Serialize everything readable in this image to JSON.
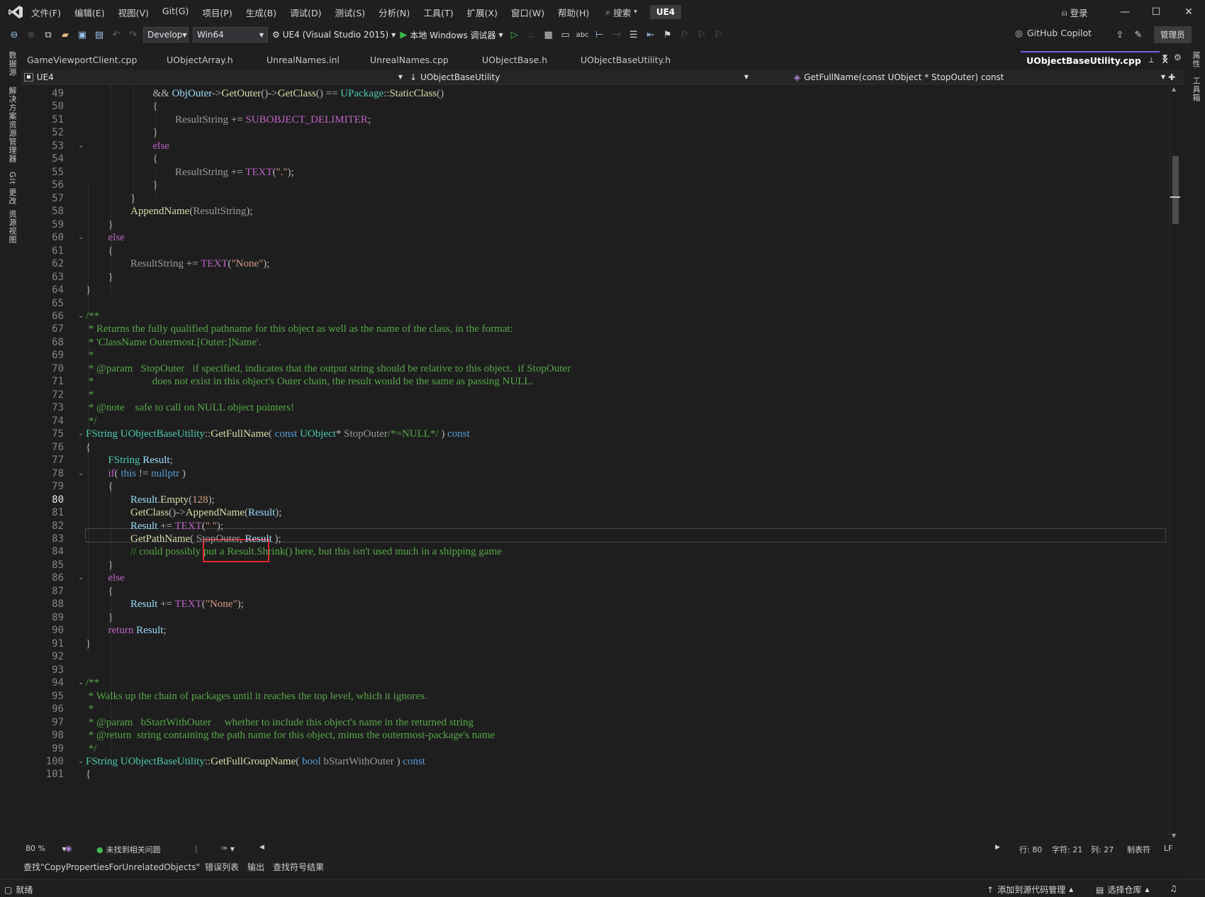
{
  "menu": {
    "items": [
      "文件(F)",
      "编辑(E)",
      "视图(V)",
      "Git(G)",
      "项目(P)",
      "生成(B)",
      "调试(D)",
      "测试(S)",
      "分析(N)",
      "工具(T)",
      "扩展(X)",
      "窗口(W)",
      "帮助(H)"
    ],
    "search_label": "搜索",
    "solution_badge": "UE4",
    "login_label": "登录"
  },
  "toolbar": {
    "config_value": "Develop",
    "platform_value": "Win64",
    "startup_project": "UE4 (Visual Studio 2015)",
    "debugger_label": "本地 Windows 调试器",
    "copilot_label": "GitHub Copilot",
    "admin_label": "管理员"
  },
  "left_strip": {
    "tabs": [
      "数据源",
      "解决方案资源管理器",
      "Git 更改",
      "资源视图"
    ]
  },
  "right_strip": {
    "tabs": [
      "属性",
      "工具箱"
    ]
  },
  "doc_tabs": {
    "tabs": [
      "GameViewportClient.cpp",
      "UObjectArray.h",
      "UnrealNames.inl",
      "UnrealNames.cpp",
      "UObjectBase.h",
      "UObjectBaseUtility.h"
    ],
    "active": "UObjectBaseUtility.cpp"
  },
  "navbar": {
    "project": "UE4",
    "scope": "UObjectBaseUtility",
    "member": "GetFullName(const UObject * StopOuter) const"
  },
  "editor": {
    "current_line": 80,
    "highlighted_token": "AppendName",
    "lines": [
      {
        "n": "49",
        "fold": "",
        "indent": 3,
        "toks": [
          {
            "t": "&& ",
            "c": "op"
          },
          {
            "t": "ObjOuter",
            "c": "va"
          },
          {
            "t": "->",
            "c": "op"
          },
          {
            "t": "GetOuter",
            "c": "fn"
          },
          {
            "t": "()",
            "c": "op"
          },
          {
            "t": "->",
            "c": "op"
          },
          {
            "t": "GetClass",
            "c": "fn"
          },
          {
            "t": "() == ",
            "c": "op"
          },
          {
            "t": "UPackage",
            "c": "ty"
          },
          {
            "t": "::",
            "c": "op"
          },
          {
            "t": "StaticClass",
            "c": "fn"
          },
          {
            "t": "()",
            "c": "op"
          }
        ]
      },
      {
        "n": "50",
        "fold": "",
        "indent": 3,
        "toks": [
          {
            "t": "{",
            "c": "op"
          }
        ]
      },
      {
        "n": "51",
        "fold": "",
        "indent": 4,
        "toks": [
          {
            "t": "ResultString",
            "c": "pm"
          },
          {
            "t": " += ",
            "c": "op"
          },
          {
            "t": "SUBOBJECT_DELIMITER",
            "c": "mc"
          },
          {
            "t": ";",
            "c": "op"
          }
        ]
      },
      {
        "n": "52",
        "fold": "",
        "indent": 3,
        "toks": [
          {
            "t": "}",
            "c": "op"
          }
        ]
      },
      {
        "n": "53",
        "fold": "⌄",
        "indent": 3,
        "toks": [
          {
            "t": "else",
            "c": "mc"
          }
        ]
      },
      {
        "n": "54",
        "fold": "",
        "indent": 3,
        "toks": [
          {
            "t": "{",
            "c": "op"
          }
        ]
      },
      {
        "n": "55",
        "fold": "",
        "indent": 4,
        "toks": [
          {
            "t": "ResultString",
            "c": "pm"
          },
          {
            "t": " += ",
            "c": "op"
          },
          {
            "t": "TEXT",
            "c": "mc"
          },
          {
            "t": "(",
            "c": "op"
          },
          {
            "t": "\".\"",
            "c": "st"
          },
          {
            "t": ");",
            "c": "op"
          }
        ]
      },
      {
        "n": "56",
        "fold": "",
        "indent": 3,
        "toks": [
          {
            "t": "}",
            "c": "op"
          }
        ]
      },
      {
        "n": "57",
        "fold": "",
        "indent": 2,
        "toks": [
          {
            "t": "}",
            "c": "op"
          }
        ]
      },
      {
        "n": "58",
        "fold": "",
        "indent": 2,
        "toks": [
          {
            "t": "AppendName",
            "c": "fn"
          },
          {
            "t": "(",
            "c": "op"
          },
          {
            "t": "ResultString",
            "c": "pm"
          },
          {
            "t": ");",
            "c": "op"
          }
        ]
      },
      {
        "n": "59",
        "fold": "",
        "indent": 1,
        "toks": [
          {
            "t": "}",
            "c": "op"
          }
        ]
      },
      {
        "n": "60",
        "fold": "⌄",
        "indent": 1,
        "toks": [
          {
            "t": "else",
            "c": "mc"
          }
        ]
      },
      {
        "n": "61",
        "fold": "",
        "indent": 1,
        "toks": [
          {
            "t": "{",
            "c": "op"
          }
        ]
      },
      {
        "n": "62",
        "fold": "",
        "indent": 2,
        "toks": [
          {
            "t": "ResultString",
            "c": "pm"
          },
          {
            "t": " += ",
            "c": "op"
          },
          {
            "t": "TEXT",
            "c": "mc"
          },
          {
            "t": "(",
            "c": "op"
          },
          {
            "t": "\"None\"",
            "c": "st"
          },
          {
            "t": ");",
            "c": "op"
          }
        ]
      },
      {
        "n": "63",
        "fold": "",
        "indent": 1,
        "toks": [
          {
            "t": "}",
            "c": "op"
          }
        ]
      },
      {
        "n": "64",
        "fold": "",
        "indent": 0,
        "toks": [
          {
            "t": "}",
            "c": "op"
          }
        ]
      },
      {
        "n": "65",
        "fold": "",
        "indent": 0,
        "toks": []
      },
      {
        "n": "66",
        "fold": "⌄",
        "indent": 0,
        "toks": [
          {
            "t": "/**",
            "c": "cm"
          }
        ]
      },
      {
        "n": "67",
        "fold": "",
        "indent": 0,
        "toks": [
          {
            "t": " * Returns the fully qualified pathname for this object as well as the name of the class, in the format:",
            "c": "cm"
          }
        ]
      },
      {
        "n": "68",
        "fold": "",
        "indent": 0,
        "toks": [
          {
            "t": " * 'ClassName Outermost.[Outer:]Name'.",
            "c": "cm"
          }
        ]
      },
      {
        "n": "69",
        "fold": "",
        "indent": 0,
        "toks": [
          {
            "t": " *",
            "c": "cm"
          }
        ]
      },
      {
        "n": "70",
        "fold": "",
        "indent": 0,
        "toks": [
          {
            "t": " * @param   StopOuter   if specified, indicates that the output string should be relative to this object.  if StopOuter",
            "c": "cm"
          }
        ]
      },
      {
        "n": "71",
        "fold": "",
        "indent": 0,
        "toks": [
          {
            "t": " *                      does not exist in this object's Outer chain, the result would be the same as passing NULL.",
            "c": "cm"
          }
        ]
      },
      {
        "n": "72",
        "fold": "",
        "indent": 0,
        "toks": [
          {
            "t": " *",
            "c": "cm"
          }
        ]
      },
      {
        "n": "73",
        "fold": "",
        "indent": 0,
        "toks": [
          {
            "t": " * @note    safe to call on NULL object pointers!",
            "c": "cm"
          }
        ]
      },
      {
        "n": "74",
        "fold": "",
        "indent": 0,
        "toks": [
          {
            "t": " */",
            "c": "cm"
          }
        ]
      },
      {
        "n": "75",
        "fold": "⌄",
        "indent": 0,
        "toks": [
          {
            "t": "FString",
            "c": "ty"
          },
          {
            "t": " ",
            "c": "op"
          },
          {
            "t": "UObjectBaseUtility",
            "c": "ty"
          },
          {
            "t": "::",
            "c": "op"
          },
          {
            "t": "GetFullName",
            "c": "fn"
          },
          {
            "t": "( ",
            "c": "op"
          },
          {
            "t": "const",
            "c": "kw"
          },
          {
            "t": " ",
            "c": "op"
          },
          {
            "t": "UObject",
            "c": "ty"
          },
          {
            "t": "* ",
            "c": "op"
          },
          {
            "t": "StopOuter",
            "c": "pm"
          },
          {
            "t": "/*=NULL*/",
            "c": "cm"
          },
          {
            "t": " ) ",
            "c": "op"
          },
          {
            "t": "const",
            "c": "kw"
          }
        ]
      },
      {
        "n": "76",
        "fold": "",
        "indent": 0,
        "toks": [
          {
            "t": "{",
            "c": "op"
          }
        ]
      },
      {
        "n": "77",
        "fold": "",
        "indent": 1,
        "toks": [
          {
            "t": "FString",
            "c": "ty"
          },
          {
            "t": " ",
            "c": "op"
          },
          {
            "t": "Result",
            "c": "va"
          },
          {
            "t": ";",
            "c": "op"
          }
        ]
      },
      {
        "n": "78",
        "fold": "⌄",
        "indent": 1,
        "toks": [
          {
            "t": "if",
            "c": "mc"
          },
          {
            "t": "( ",
            "c": "op"
          },
          {
            "t": "this",
            "c": "kw"
          },
          {
            "t": " != ",
            "c": "op"
          },
          {
            "t": "nullptr",
            "c": "kw"
          },
          {
            "t": " )",
            "c": "op"
          }
        ]
      },
      {
        "n": "79",
        "fold": "",
        "indent": 1,
        "toks": [
          {
            "t": "{",
            "c": "op"
          }
        ]
      },
      {
        "n": "80",
        "fold": "",
        "indent": 2,
        "toks": [
          {
            "t": "Result",
            "c": "va"
          },
          {
            "t": ".",
            "c": "op"
          },
          {
            "t": "Empty",
            "c": "fn"
          },
          {
            "t": "(",
            "c": "op"
          },
          {
            "t": "128",
            "c": "st"
          },
          {
            "t": ");",
            "c": "op"
          }
        ]
      },
      {
        "n": "81",
        "fold": "",
        "indent": 2,
        "toks": [
          {
            "t": "GetClass",
            "c": "fn"
          },
          {
            "t": "()->",
            "c": "op"
          },
          {
            "t": "AppendName",
            "c": "fn"
          },
          {
            "t": "(",
            "c": "op"
          },
          {
            "t": "Result",
            "c": "va"
          },
          {
            "t": ");",
            "c": "op"
          }
        ]
      },
      {
        "n": "82",
        "fold": "",
        "indent": 2,
        "toks": [
          {
            "t": "Result",
            "c": "va"
          },
          {
            "t": " += ",
            "c": "op"
          },
          {
            "t": "TEXT",
            "c": "mc"
          },
          {
            "t": "(",
            "c": "op"
          },
          {
            "t": "\" \"",
            "c": "st"
          },
          {
            "t": ");",
            "c": "op"
          }
        ]
      },
      {
        "n": "83",
        "fold": "",
        "indent": 2,
        "toks": [
          {
            "t": "GetPathName",
            "c": "fn"
          },
          {
            "t": "( ",
            "c": "op"
          },
          {
            "t": "StopOuter",
            "c": "pm"
          },
          {
            "t": ", ",
            "c": "op"
          },
          {
            "t": "Result",
            "c": "va"
          },
          {
            "t": " );",
            "c": "op"
          }
        ]
      },
      {
        "n": "84",
        "fold": "",
        "indent": 2,
        "toks": [
          {
            "t": "// could possibly put a Result.Shrink() here, but this isn't used much in a shipping game",
            "c": "cm"
          }
        ]
      },
      {
        "n": "85",
        "fold": "",
        "indent": 1,
        "toks": [
          {
            "t": "}",
            "c": "op"
          }
        ]
      },
      {
        "n": "86",
        "fold": "⌄",
        "indent": 1,
        "toks": [
          {
            "t": "else",
            "c": "mc"
          }
        ]
      },
      {
        "n": "87",
        "fold": "",
        "indent": 1,
        "toks": [
          {
            "t": "{",
            "c": "op"
          }
        ]
      },
      {
        "n": "88",
        "fold": "",
        "indent": 2,
        "toks": [
          {
            "t": "Result",
            "c": "va"
          },
          {
            "t": " += ",
            "c": "op"
          },
          {
            "t": "TEXT",
            "c": "mc"
          },
          {
            "t": "(",
            "c": "op"
          },
          {
            "t": "\"None\"",
            "c": "st"
          },
          {
            "t": ");",
            "c": "op"
          }
        ]
      },
      {
        "n": "89",
        "fold": "",
        "indent": 1,
        "toks": [
          {
            "t": "}",
            "c": "op"
          }
        ]
      },
      {
        "n": "90",
        "fold": "",
        "indent": 1,
        "toks": [
          {
            "t": "return",
            "c": "mc"
          },
          {
            "t": " ",
            "c": "op"
          },
          {
            "t": "Result",
            "c": "va"
          },
          {
            "t": ";",
            "c": "op"
          }
        ]
      },
      {
        "n": "91",
        "fold": "",
        "indent": 0,
        "toks": [
          {
            "t": "}",
            "c": "op"
          }
        ]
      },
      {
        "n": "92",
        "fold": "",
        "indent": 0,
        "toks": []
      },
      {
        "n": "93",
        "fold": "",
        "indent": 0,
        "toks": []
      },
      {
        "n": "94",
        "fold": "⌄",
        "indent": 0,
        "toks": [
          {
            "t": "/**",
            "c": "cm"
          }
        ]
      },
      {
        "n": "95",
        "fold": "",
        "indent": 0,
        "toks": [
          {
            "t": " * Walks up the chain of packages until it reaches the top level, which it ignores.",
            "c": "cm"
          }
        ]
      },
      {
        "n": "96",
        "fold": "",
        "indent": 0,
        "toks": [
          {
            "t": " *",
            "c": "cm"
          }
        ]
      },
      {
        "n": "97",
        "fold": "",
        "indent": 0,
        "toks": [
          {
            "t": " * @param   bStartWithOuter     whether to include this object's name in the returned string",
            "c": "cm"
          }
        ]
      },
      {
        "n": "98",
        "fold": "",
        "indent": 0,
        "toks": [
          {
            "t": " * @return  string containing the path name for this object, minus the outermost-package's name",
            "c": "cm"
          }
        ]
      },
      {
        "n": "99",
        "fold": "",
        "indent": 0,
        "toks": [
          {
            "t": " */",
            "c": "cm"
          }
        ]
      },
      {
        "n": "100",
        "fold": "⌄",
        "indent": 0,
        "toks": [
          {
            "t": "FString",
            "c": "ty"
          },
          {
            "t": " ",
            "c": "op"
          },
          {
            "t": "UObjectBaseUtility",
            "c": "ty"
          },
          {
            "t": "::",
            "c": "op"
          },
          {
            "t": "GetFullGroupName",
            "c": "fn"
          },
          {
            "t": "( ",
            "c": "op"
          },
          {
            "t": "bool",
            "c": "kw"
          },
          {
            "t": " ",
            "c": "op"
          },
          {
            "t": "bStartWithOuter",
            "c": "pm"
          },
          {
            "t": " ) ",
            "c": "op"
          },
          {
            "t": "const",
            "c": "kw"
          }
        ]
      },
      {
        "n": "101",
        "fold": "",
        "indent": 0,
        "toks": [
          {
            "t": "{",
            "c": "op"
          }
        ]
      }
    ],
    "colors": {
      "kw": "#569cd6",
      "ty": "#4ec9b0",
      "fn": "#dcdcaa",
      "mc": "#bd63c5",
      "st": "#d69d85",
      "cm": "#57a64a",
      "va": "#9cdcfe",
      "pm": "#9a9a9a",
      "op": "#b4b4b4"
    }
  },
  "edit_status": {
    "zoom": "80 %",
    "issues": "未找到相关问题",
    "line": "行: 80",
    "char": "字符: 21",
    "col": "列: 27",
    "tabs": "制表符",
    "eol": "LF"
  },
  "bottom_tabs": [
    "查找\"CopyPropertiesForUnrelatedObjects\"",
    "错误列表",
    "输出",
    "查找符号结果"
  ],
  "statusbar": {
    "ready": "就绪",
    "add_source_control": "添加到源代码管理",
    "select_repo": "选择仓库"
  }
}
